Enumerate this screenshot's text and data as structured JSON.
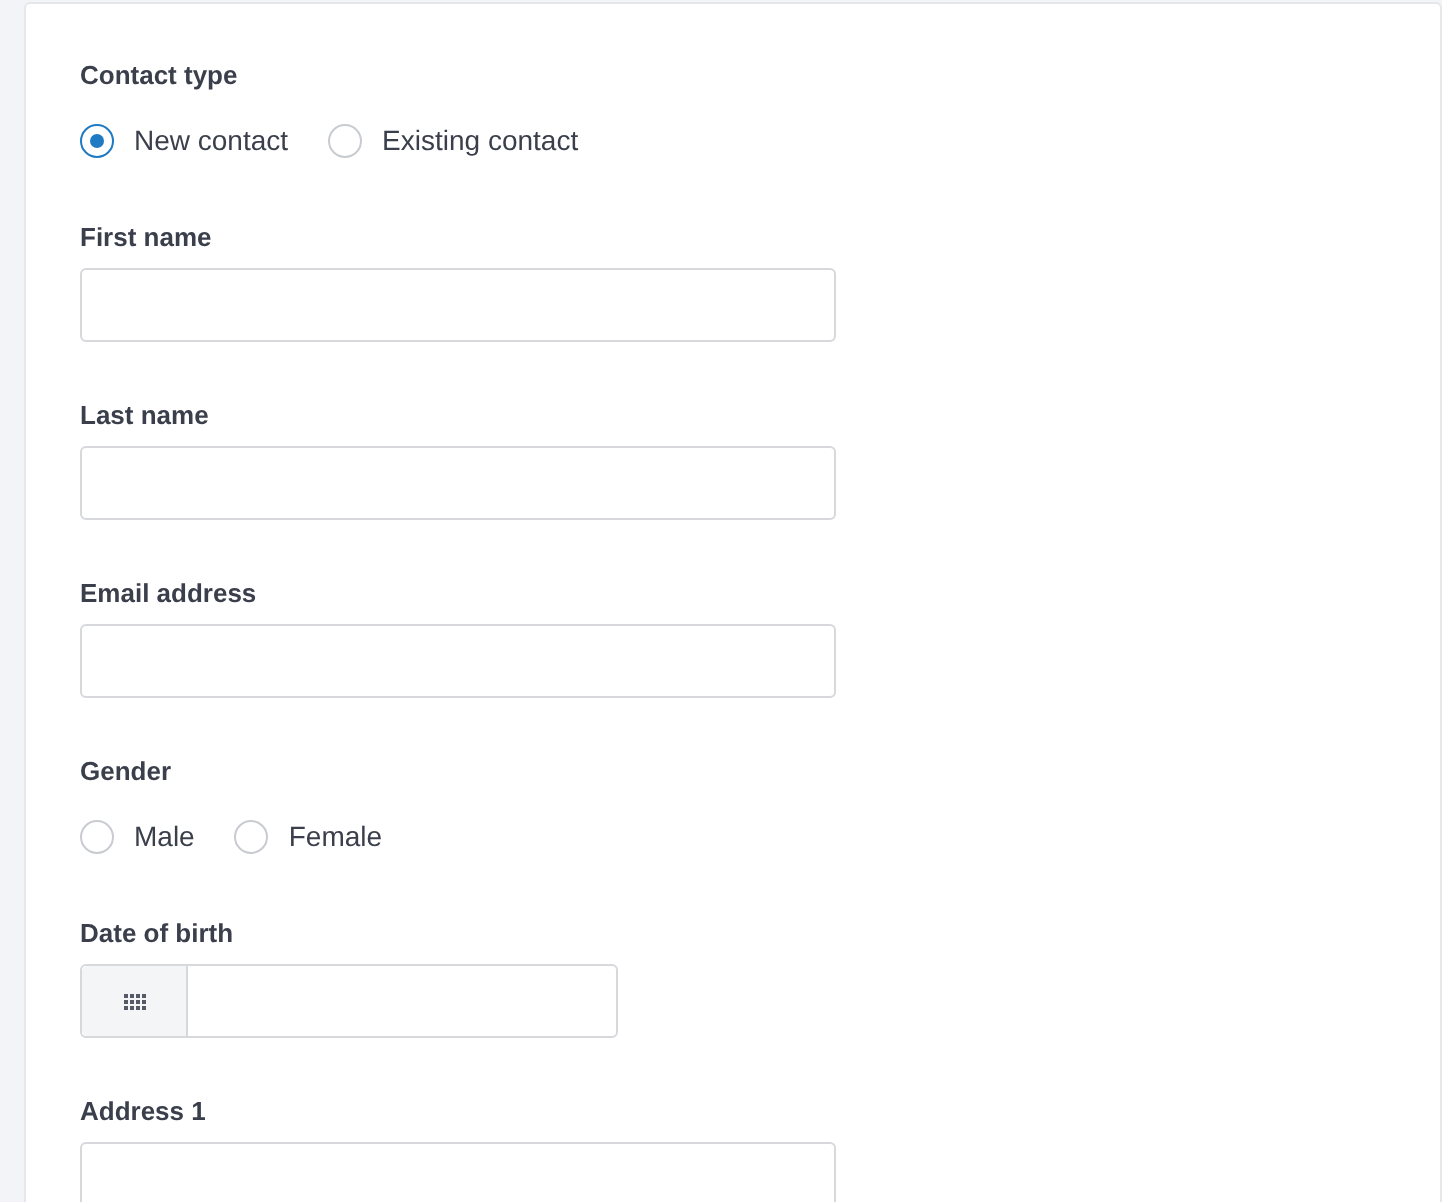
{
  "fields": [
    {
      "kind": "radio",
      "label": "Contact type",
      "options": [
        {
          "label": "New contact",
          "selected": true
        },
        {
          "label": "Existing contact",
          "selected": false
        }
      ]
    },
    {
      "kind": "text",
      "label": "First name"
    },
    {
      "kind": "text",
      "label": "Last name"
    },
    {
      "kind": "text",
      "label": "Email address"
    },
    {
      "kind": "radio",
      "label": "Gender",
      "options": [
        {
          "label": "Male",
          "selected": false
        },
        {
          "label": "Female",
          "selected": false
        }
      ]
    },
    {
      "kind": "date",
      "label": "Date of birth"
    },
    {
      "kind": "text",
      "label": "Address 1"
    }
  ]
}
